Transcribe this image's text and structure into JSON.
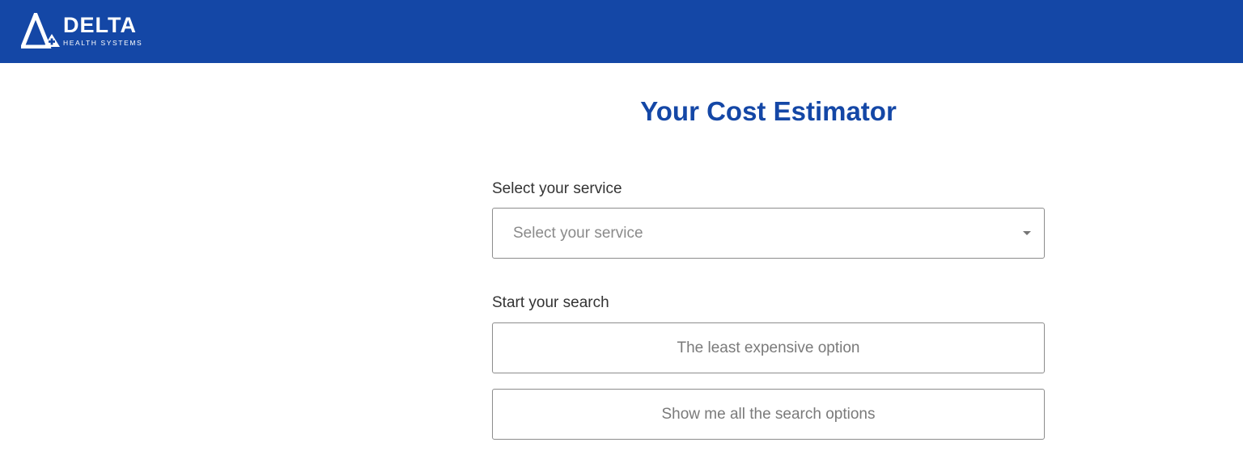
{
  "header": {
    "brand_name": "DELTA",
    "brand_tagline": "HEALTH SYSTEMS",
    "logo_icon": "delta-triangle-cross-icon",
    "background_color": "#1447a6"
  },
  "main": {
    "title": "Your Cost Estimator",
    "service": {
      "label": "Select your service",
      "placeholder": "Select your service",
      "dropdown_icon": "caret-down-icon"
    },
    "search": {
      "label": "Start your search",
      "options": [
        "The least expensive option",
        "Show me all the search options"
      ]
    }
  },
  "colors": {
    "accent": "#1447a6",
    "border": "#8c8c8c",
    "placeholder_text": "#8a8a8a"
  }
}
